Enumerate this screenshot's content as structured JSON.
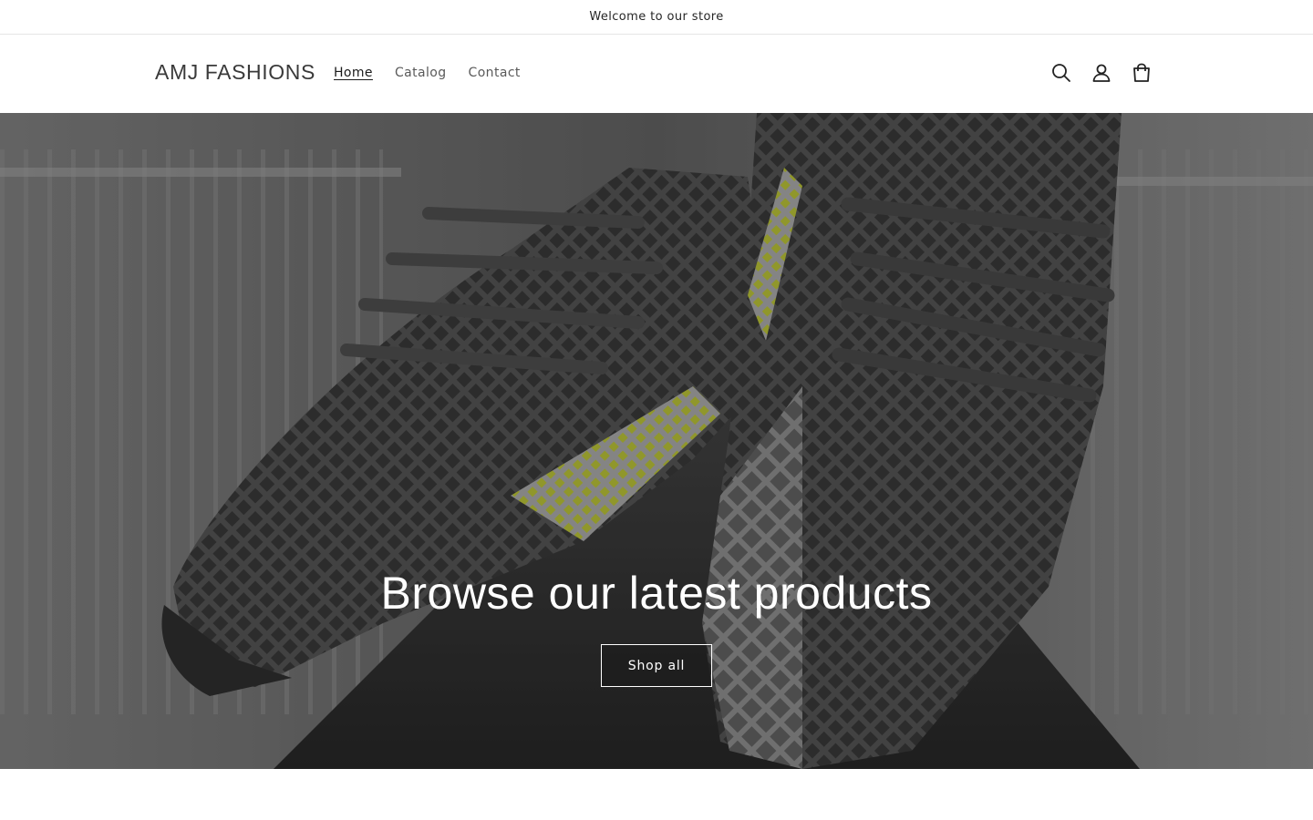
{
  "announcement": {
    "text": "Welcome to our store"
  },
  "header": {
    "logo": "AMJ FASHIONS",
    "nav": [
      {
        "label": "Home",
        "active": true
      },
      {
        "label": "Catalog",
        "active": false
      },
      {
        "label": "Contact",
        "active": false
      }
    ],
    "icons": [
      "search-icon",
      "account-icon",
      "cart-icon"
    ]
  },
  "hero": {
    "title": "Browse our latest products",
    "button_label": "Shop all",
    "colors": {
      "mesh": "#6e6e6e",
      "accent": "#c8d23c",
      "sole": "#3c3c3c"
    }
  }
}
